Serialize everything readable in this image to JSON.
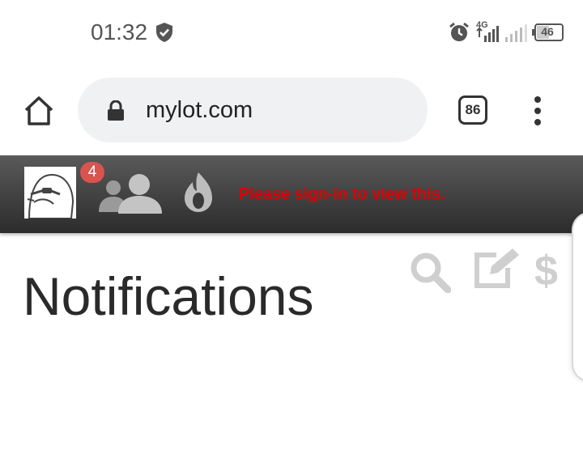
{
  "status_bar": {
    "time": "01:32",
    "network": "4G",
    "battery": "46",
    "icons": [
      "shield-icon",
      "alarm-icon",
      "signal-icon",
      "battery-icon"
    ]
  },
  "browser": {
    "url": "mylot.com",
    "tab_count": "86",
    "icons": [
      "home-icon",
      "lock-icon",
      "more-vert-icon"
    ]
  },
  "site_header": {
    "notification_count": "4",
    "message": "Please sign-in to view this.",
    "message_color": "#e00000",
    "icons": [
      "avatar",
      "friends-icon",
      "fire-icon"
    ]
  },
  "page": {
    "title": "Notifications",
    "actions": [
      "search-icon",
      "edit-icon",
      "dollar-icon"
    ],
    "dollar_glyph": "$"
  }
}
